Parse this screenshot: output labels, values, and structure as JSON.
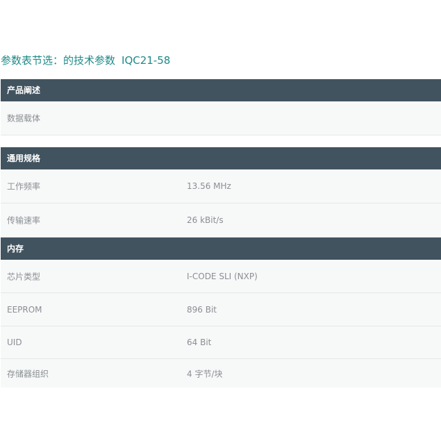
{
  "page": {
    "title_prefix": "参数表节选：的技术参数",
    "model": "IQC21-58"
  },
  "sections": [
    {
      "header": "产品阐述",
      "rows": [
        {
          "label": "数据载体",
          "value": ""
        }
      ]
    },
    {
      "header": "通用规格",
      "rows": [
        {
          "label": "工作频率",
          "value": "13.56 MHz"
        },
        {
          "label": "传输速率",
          "value": "26 kBit/s"
        }
      ]
    },
    {
      "header": "内存",
      "rows": [
        {
          "label": "芯片类型",
          "value": "I-CODE SLI (NXP)"
        },
        {
          "label": "EEPROM",
          "value": "896 Bit"
        },
        {
          "label": "UID",
          "value": "64 Bit"
        },
        {
          "label": "存储器组织",
          "value": "4 字节/块"
        }
      ]
    }
  ],
  "colors": {
    "title": "#1e8a87",
    "header_bg": "#41535f",
    "row_bg": "#f7f8f8",
    "row_text": "#8a8f93"
  }
}
